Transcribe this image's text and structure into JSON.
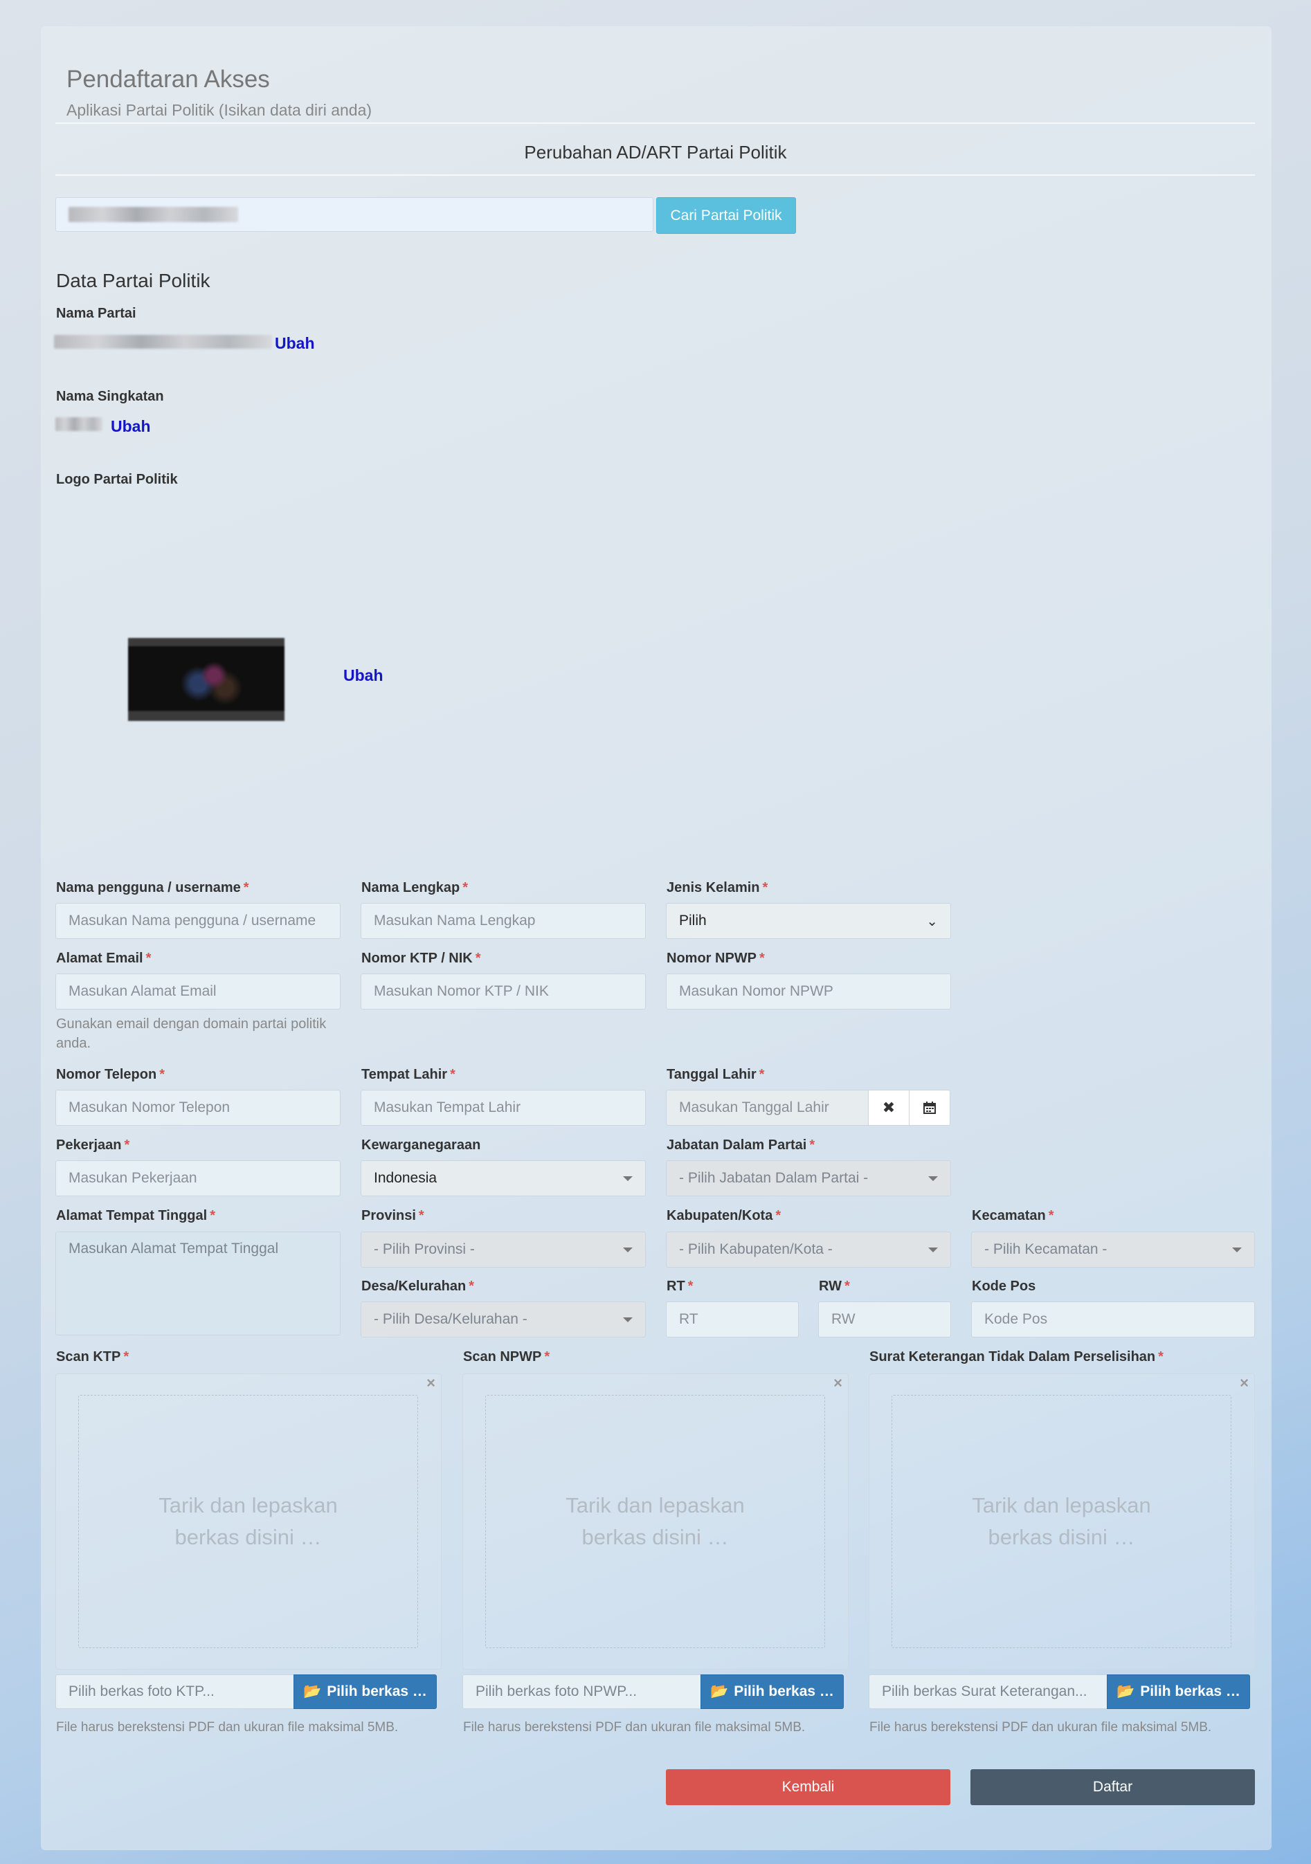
{
  "header": {
    "title": "Pendaftaran Akses",
    "subtitle": "Aplikasi Partai Politik (Isikan data diri anda)",
    "section": "Perubahan AD/ART Partai Politik"
  },
  "search": {
    "button": "Cari Partai Politik"
  },
  "party": {
    "heading": "Data Partai Politik",
    "name_label": "Nama Partai",
    "abbr_label": "Nama Singkatan",
    "logo_label": "Logo Partai Politik",
    "change": "Ubah"
  },
  "form": {
    "username": {
      "label": "Nama pengguna / username",
      "placeholder": "Masukan Nama pengguna / username"
    },
    "fullname": {
      "label": "Nama Lengkap",
      "placeholder": "Masukan Nama Lengkap"
    },
    "gender": {
      "label": "Jenis Kelamin",
      "value": "Pilih"
    },
    "email": {
      "label": "Alamat Email",
      "placeholder": "Masukan Alamat Email",
      "help": "Gunakan email dengan domain partai politik anda."
    },
    "nik": {
      "label": "Nomor KTP / NIK",
      "placeholder": "Masukan Nomor KTP / NIK"
    },
    "npwp": {
      "label": "Nomor NPWP",
      "placeholder": "Masukan Nomor NPWP"
    },
    "phone": {
      "label": "Nomor Telepon",
      "placeholder": "Masukan Nomor Telepon"
    },
    "birthplace": {
      "label": "Tempat Lahir",
      "placeholder": "Masukan Tempat Lahir"
    },
    "birthdate": {
      "label": "Tanggal Lahir",
      "placeholder": "Masukan Tanggal Lahir"
    },
    "job": {
      "label": "Pekerjaan",
      "placeholder": "Masukan Pekerjaan"
    },
    "citizenship": {
      "label": "Kewarganegaraan",
      "value": "Indonesia"
    },
    "position": {
      "label": "Jabatan Dalam Partai",
      "value": "- Pilih Jabatan Dalam Partai -"
    },
    "address": {
      "label": "Alamat Tempat Tinggal",
      "placeholder": "Masukan Alamat Tempat Tinggal"
    },
    "province": {
      "label": "Provinsi",
      "value": "- Pilih Provinsi -"
    },
    "regency": {
      "label": "Kabupaten/Kota",
      "value": "- Pilih Kabupaten/Kota -"
    },
    "district": {
      "label": "Kecamatan",
      "value": "- Pilih Kecamatan -"
    },
    "village": {
      "label": "Desa/Kelurahan",
      "value": "- Pilih Desa/Kelurahan -"
    },
    "rt": {
      "label": "RT",
      "placeholder": "RT"
    },
    "rw": {
      "label": "RW",
      "placeholder": "RW"
    },
    "postcode": {
      "label": "Kode Pos",
      "placeholder": "Kode Pos"
    },
    "required_mark": "*"
  },
  "uploads": [
    {
      "label": "Scan KTP",
      "drop": "Tarik dan lepaskan berkas disini …",
      "placeholder": "Pilih berkas foto KTP...",
      "button": "Pilih berkas …",
      "help": "File harus berekstensi PDF dan ukuran file maksimal 5MB."
    },
    {
      "label": "Scan NPWP",
      "drop": "Tarik dan lepaskan berkas disini …",
      "placeholder": "Pilih berkas foto NPWP...",
      "button": "Pilih berkas …",
      "help": "File harus berekstensi PDF dan ukuran file maksimal 5MB."
    },
    {
      "label": "Surat Keterangan Tidak Dalam Perselisihan",
      "drop": "Tarik dan lepaskan berkas disini …",
      "placeholder": "Pilih berkas Surat Keterangan...",
      "button": "Pilih berkas …",
      "help": "File harus berekstensi PDF dan ukuran file maksimal 5MB."
    }
  ],
  "actions": {
    "back": "Kembali",
    "submit": "Daftar"
  },
  "colors": {
    "info": "#5bc0de",
    "primary": "#337ab7",
    "danger": "#d9534f",
    "dark": "#4a5b6c",
    "link": "#1515c8"
  }
}
